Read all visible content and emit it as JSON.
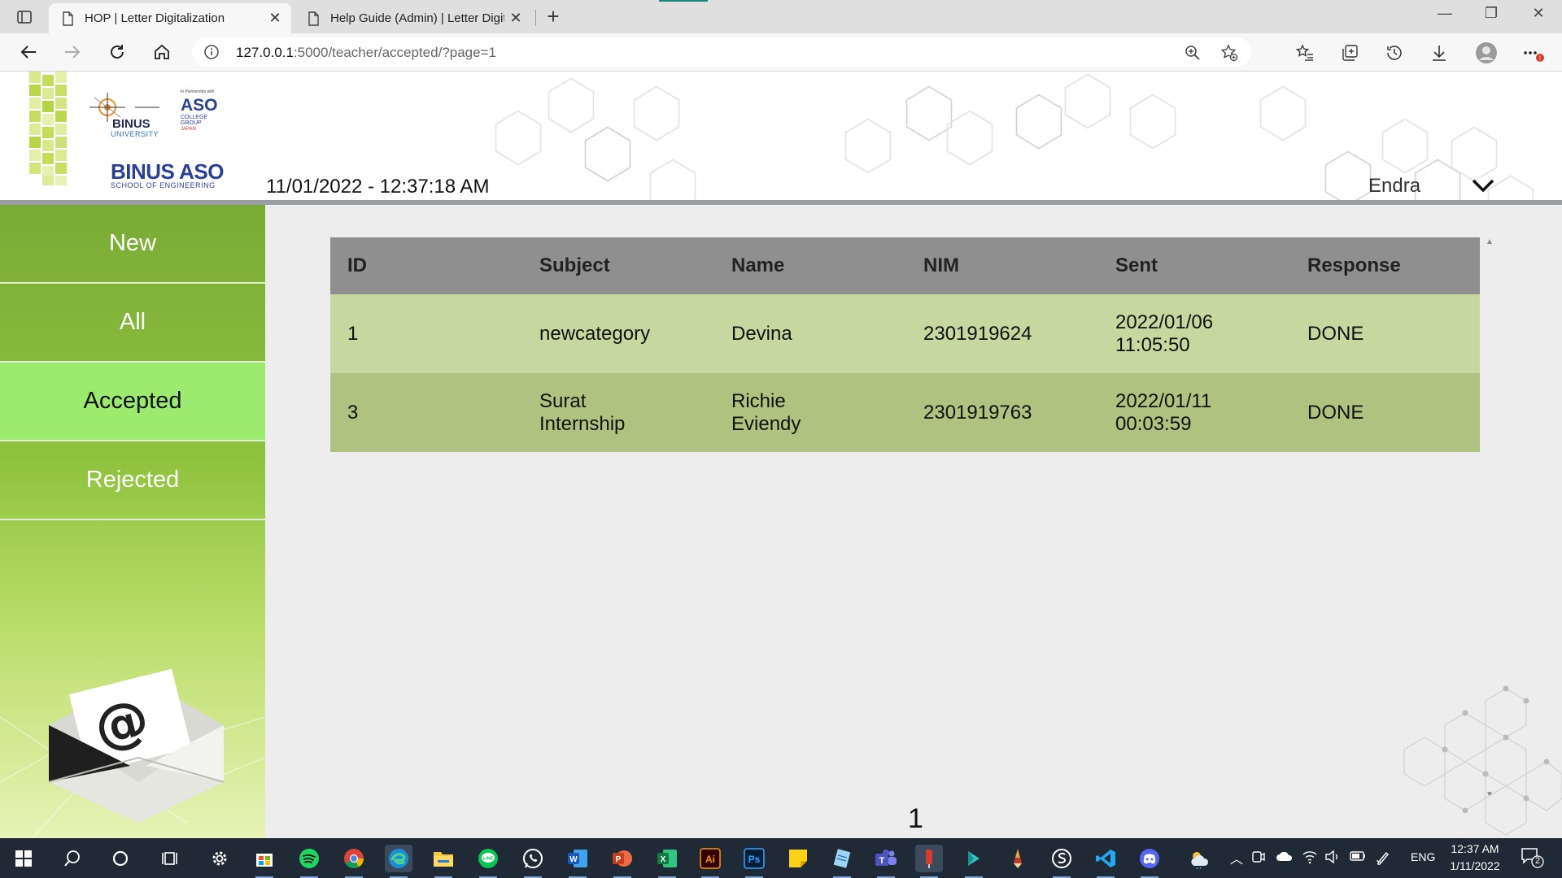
{
  "browser": {
    "tabs": [
      {
        "title": "HOP | Letter Digitalization",
        "active": true
      },
      {
        "title": "Help Guide (Admin) | Letter Digit",
        "active": false
      }
    ],
    "url_host": "127.0.0.1",
    "url_path": ":5000/teacher/accepted/?page=1"
  },
  "header": {
    "logo_primary": "BINUS",
    "logo_primary_sub": "UNIVERSITY",
    "logo_partner_small": "In Partnership with",
    "logo_partner": "ASO",
    "logo_partner_sub1": "COLLEGE",
    "logo_partner_sub2": "GROUP",
    "logo_partner_sub3": "JAPAN",
    "brand_title": "BINUS ASO",
    "brand_subtitle": "SCHOOL OF ENGINEERING",
    "datetime": "11/01/2022 - 12:37:18 AM",
    "user": "Endra"
  },
  "sidebar": {
    "items": [
      {
        "label": "New"
      },
      {
        "label": "All"
      },
      {
        "label": "Accepted",
        "active": true
      },
      {
        "label": "Rejected"
      }
    ]
  },
  "table": {
    "columns": [
      "ID",
      "Subject",
      "Name",
      "NIM",
      "Sent",
      "Response"
    ],
    "rows": [
      {
        "id": "1",
        "subject": "newcategory",
        "name": "Devina",
        "nim": "2301919624",
        "sent_date": "2022/01/06",
        "sent_time": "11:05:50",
        "response": "DONE"
      },
      {
        "id": "3",
        "subject_1": "Surat",
        "subject_2": "Internship",
        "name_1": "Richie",
        "name_2": "Eviendy",
        "nim": "2301919763",
        "sent_date": "2022/01/11",
        "sent_time": "00:03:59",
        "response": "DONE"
      }
    ]
  },
  "pagination": {
    "current": "1"
  },
  "taskbar": {
    "apps": [
      "windows-start",
      "search",
      "cortana",
      "task-view",
      "settings",
      "microsoft-store",
      "spotify",
      "chrome",
      "edge",
      "file-explorer",
      "line",
      "whatsapp",
      "word",
      "powerpoint",
      "excel",
      "illustrator",
      "photoshop",
      "sticky-notes",
      "notepad",
      "teams",
      "app-red",
      "app-arrow",
      "pencil",
      "app-s",
      "vscode",
      "discord"
    ],
    "language": "ENG",
    "time": "12:37 AM",
    "date": "1/11/2022",
    "notifications": "2"
  },
  "colors": {
    "sidebar_green": "#7aab36",
    "active_menu": "#9ceb6e",
    "table_header": "#8f8f8f",
    "row_light": "#c4d8a0",
    "row_dark": "#aec37f"
  }
}
